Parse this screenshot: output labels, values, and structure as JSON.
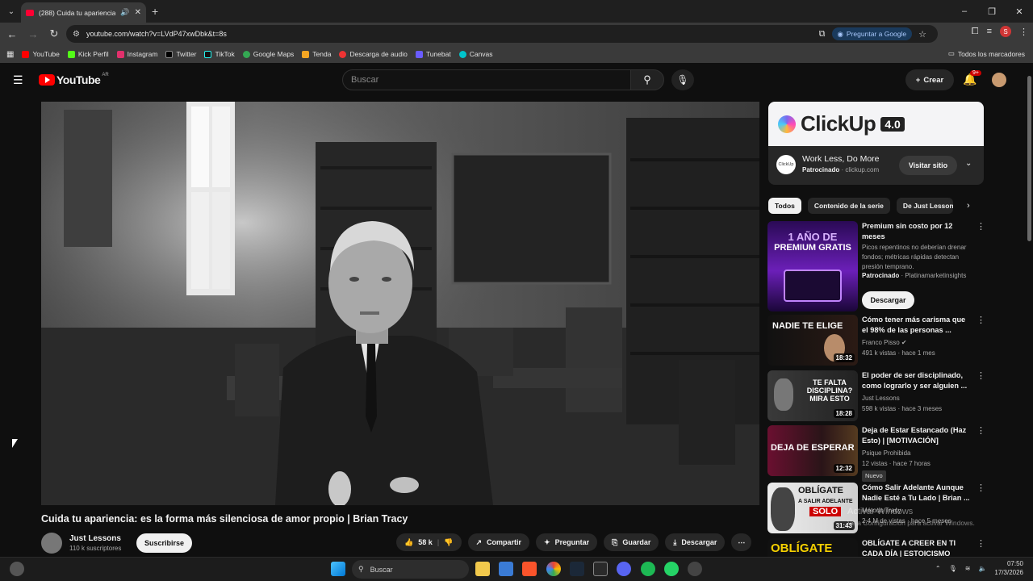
{
  "browser": {
    "tab_title": "(288) Cuida tu apariencia: e",
    "url": "youtube.com/watch?v=LVdP47xwDbk&t=8s",
    "ask_google": "Preguntar a Google",
    "bookmarks": [
      "YouTube",
      "Kick Perfil",
      "Instagram",
      "Twitter",
      "TikTok",
      "Google Maps",
      "Tenda",
      "Descarga de audio",
      "Tunebat",
      "Canvas"
    ],
    "bookmarks_all": "Todos los marcadores",
    "profile_letter": "S"
  },
  "youtube": {
    "logo": "YouTube",
    "region": "AR",
    "search_placeholder": "Buscar",
    "create_label": "Crear",
    "notif_badge": "9+"
  },
  "video": {
    "title": "Cuida tu apariencia: es la forma más silenciosa de amor propio | Brian Tracy",
    "channel": "Just Lessons",
    "subscribers": "110 k suscriptores",
    "subscribe": "Suscribirse",
    "likes": "58 k",
    "share": "Compartir",
    "ask": "Preguntar",
    "save": "Guardar",
    "download": "Descargar"
  },
  "ad": {
    "brand": "ClickUp",
    "version": "4.0",
    "logo_text": "ClickUp",
    "headline": "Work Less, Do More",
    "sponsored": "Patrocinado",
    "domain": "clickup.com",
    "cta": "Visitar sitio"
  },
  "chips": [
    "Todos",
    "Contenido de la serie",
    "De Just Lessons"
  ],
  "recommendations": [
    {
      "title": "Premium sin costo por 12 meses",
      "desc": "Picos repentinos no deberían drenar fondos; métricas rápidas detectan presión temprano.",
      "sponsored": "Patrocinado",
      "advertiser": "Platinamarketinsights",
      "cta": "Descargar",
      "thumb_line1": "1 AÑO DE",
      "thumb_line2": "PREMIUM GRATIS"
    },
    {
      "title": "Cómo tener más carisma que el 98% de las personas ...",
      "channel": "Franco Pisso",
      "meta": "491 k vistas · hace 1 mes",
      "duration": "18:32",
      "thumb_text": "NADIE TE ELIGE"
    },
    {
      "title": "El poder de ser disciplinado, como lograrlo y ser alguien ...",
      "channel": "Just Lessons",
      "meta": "598 k vistas · hace 3 meses",
      "duration": "18:28",
      "thumb_text": "TE FALTA DISCIPLINA? MIRA ESTO"
    },
    {
      "title": "Deja de Estar Estancado (Haz Esto) | [MOTIVACIÓN]",
      "channel": "Psique Prohibida",
      "meta": "12 vistas · hace 7 horas",
      "badge": "Nuevo",
      "duration": "12:32",
      "thumb_text": "DEJA DE ESPERAR"
    },
    {
      "title": "Cómo Salir Adelante Aunque Nadie Esté a Tu Lado | Brian ...",
      "channel": "Método Tracy",
      "meta": "2,4 M de vistas · hace 5 meses",
      "duration": "31:43",
      "thumb_line1": "OBLÍGATE",
      "thumb_line2": "A SALIR ADELANTE",
      "thumb_line3": "SOLO"
    },
    {
      "title": "OBLÍGATE A CREER EN TI CADA DÍA | ESTOICISMO",
      "thumb_text": "OBLÍGATE"
    }
  ],
  "watermark": {
    "line1": "Activar Windows",
    "line2": "Ve a Configuración para activar Windows."
  },
  "taskbar": {
    "search": "Buscar",
    "time": "07:50",
    "date": "17/3/2026"
  },
  "colors": {
    "yt_red": "#ff0000",
    "bg": "#0f0f0f",
    "chip_active": "#f1f1f1"
  }
}
